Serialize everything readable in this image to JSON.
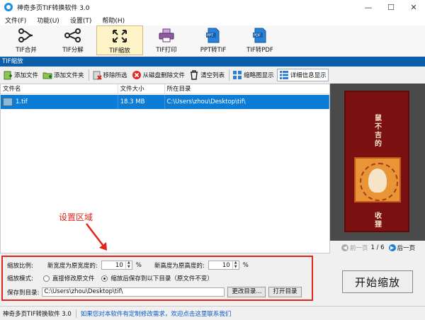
{
  "window": {
    "title": "神奇多页TIF转换软件 3.0",
    "minimize": "—",
    "maximize": "☐",
    "close": "✕"
  },
  "menu": [
    "文件(F)",
    "功能(U)",
    "设置(T)",
    "帮助(H)"
  ],
  "toolbar": [
    {
      "label": "TIF合并",
      "icon": "merge-icon",
      "active": false
    },
    {
      "label": "TIF分解",
      "icon": "split-icon",
      "active": false
    },
    {
      "label": "TIF缩放",
      "icon": "resize-icon",
      "active": true
    },
    {
      "label": "TIF打印",
      "icon": "printer-icon",
      "active": false
    },
    {
      "label": "PPT转TIF",
      "icon": "ppt-file-icon",
      "active": false
    },
    {
      "label": "TIF转PDF",
      "icon": "pdf-file-icon",
      "active": false
    }
  ],
  "section_title": "TIF缩放",
  "actions": {
    "add_file": "添加文件",
    "add_folder": "添加文件夹",
    "remove_selected": "移除所选",
    "delete_from_disk": "从磁盘删除文件",
    "clear_list": "清空列表",
    "thumbnail_view": "缩略图显示",
    "detail_view": "详细信息显示"
  },
  "file_list": {
    "columns": [
      "文件名",
      "文件大小",
      "所在目录"
    ],
    "rows": [
      {
        "name": "1.tif",
        "size": "18.3 MB",
        "dir": "C:\\Users\\zhou\\Desktop\\tif\\"
      }
    ]
  },
  "preview": {
    "poster_top": "鼠不吉的",
    "poster_bottom": "收狸",
    "prev": "前一页",
    "page": "1 / 6",
    "next": "后一页"
  },
  "annotation": "设置区域",
  "settings": {
    "scale_label": "缩放比例:",
    "width_label": "新宽度为原宽度的:",
    "width_value": "10",
    "width_unit": "%",
    "height_label": "新高度为原高度的:",
    "height_value": "10",
    "height_unit": "%",
    "mode_label": "缩放模式:",
    "mode_option1": "直接修改原文件",
    "mode_option2": "缩放后保存到以下目录（原文件不变）",
    "selected_mode": 2,
    "save_label": "保存到目录:",
    "save_path": "C:\\Users\\zhou\\Desktop\\tif\\",
    "change_dir": "更改目录...",
    "open_dir": "打开目录"
  },
  "start_button": "开始缩放",
  "status": {
    "app_name": "神奇多页TIF转换软件 3.0",
    "message": "如果您对本软件有定制修改需求，欢迎点击这里联系我们"
  },
  "colors": {
    "accent": "#0c5ea8",
    "selection": "#0c7cd5",
    "annotation": "#e0261b"
  }
}
